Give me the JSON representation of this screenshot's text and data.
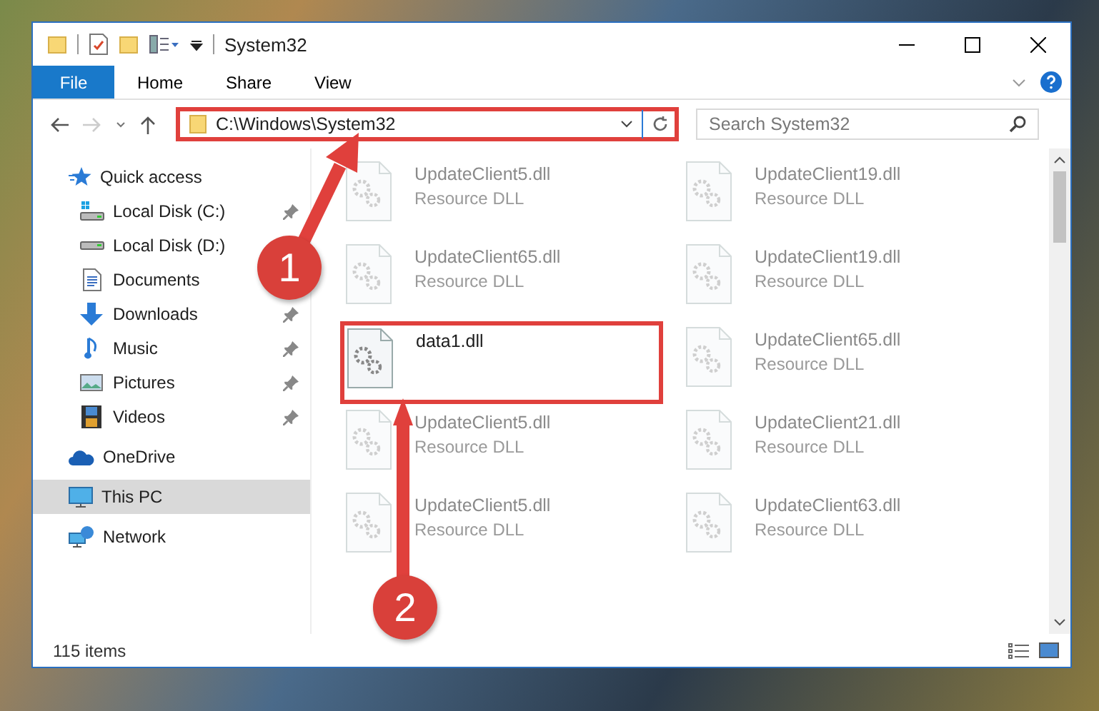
{
  "window": {
    "title": "System32"
  },
  "ribbon_tabs": [
    {
      "label": "File",
      "kind": "file"
    },
    {
      "label": "Home",
      "kind": "tab"
    },
    {
      "label": "Share",
      "kind": "tab"
    },
    {
      "label": "View",
      "kind": "tab"
    }
  ],
  "address_bar": {
    "path": "C:\\Windows\\System32",
    "highlighted": true
  },
  "search": {
    "placeholder": "Search System32"
  },
  "navigation": [
    {
      "label": "Quick access",
      "kind": "star",
      "selected": false,
      "children": [
        {
          "label": "Local Disk (C:)",
          "kind": "drive-windows",
          "pinned": true
        },
        {
          "label": "Local Disk (D:)",
          "kind": "drive",
          "pinned": false
        },
        {
          "label": "Documents",
          "kind": "documents",
          "pinned": false
        },
        {
          "label": "Downloads",
          "kind": "downloads",
          "pinned": true
        },
        {
          "label": "Music",
          "kind": "music",
          "pinned": true
        },
        {
          "label": "Pictures",
          "kind": "pictures",
          "pinned": true
        },
        {
          "label": "Videos",
          "kind": "videos",
          "pinned": true
        }
      ]
    },
    {
      "label": "OneDrive",
      "kind": "cloud",
      "selected": false
    },
    {
      "label": "This PC",
      "kind": "pc",
      "selected": true
    },
    {
      "label": "Network",
      "kind": "network",
      "selected": false
    }
  ],
  "files": [
    {
      "name": "UpdateClient5.dll",
      "type": "Resource DLL",
      "blurred": true,
      "highlighted": false
    },
    {
      "name": "UpdateClient19.dll",
      "type": "Resource DLL",
      "blurred": true,
      "highlighted": false
    },
    {
      "name": "UpdateClient65.dll",
      "type": "Resource DLL",
      "blurred": true,
      "highlighted": false
    },
    {
      "name": "UpdateClient19.dll",
      "type": "Resource DLL",
      "blurred": true,
      "highlighted": false
    },
    {
      "name": "data1.dll",
      "blurred": false,
      "highlighted": true
    },
    {
      "name": "UpdateClient65.dll",
      "type": "Resource DLL",
      "blurred": true,
      "highlighted": false
    },
    {
      "name": "UpdateClient5.dll",
      "type": "Resource DLL",
      "blurred": true,
      "highlighted": false
    },
    {
      "name": "UpdateClient21.dll",
      "type": "Resource DLL",
      "blurred": true,
      "highlighted": false
    },
    {
      "name": "UpdateClient5.dll",
      "type": "Resource DLL",
      "blurred": true,
      "highlighted": false
    },
    {
      "name": "UpdateClient63.dll",
      "type": "Resource DLL",
      "blurred": true,
      "highlighted": false
    }
  ],
  "status_bar": {
    "item_count": "115 items"
  },
  "callouts": [
    {
      "number": "1"
    },
    {
      "number": "2"
    }
  ]
}
